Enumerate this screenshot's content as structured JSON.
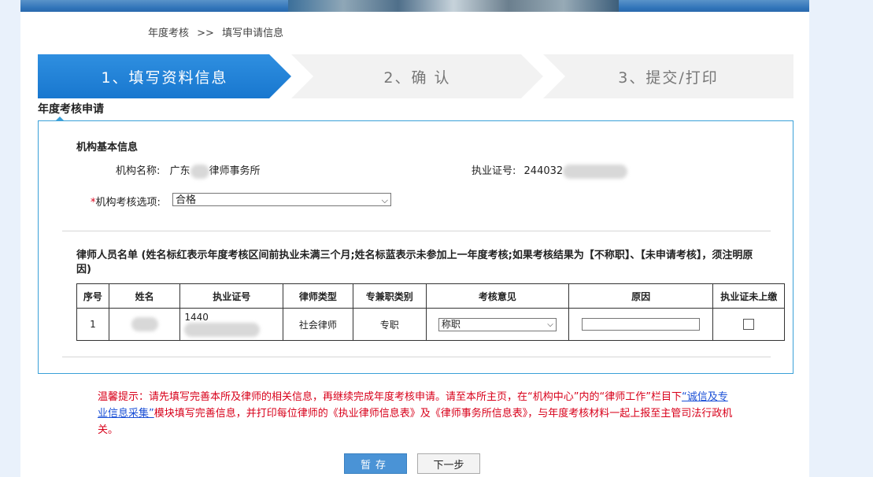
{
  "breadcrumb": {
    "root": "年度考核",
    "separator": ">>",
    "current": "填写申请信息"
  },
  "steps": [
    {
      "label": "1、填写资料信息",
      "active": true
    },
    {
      "label": "2、确 认",
      "active": false
    },
    {
      "label": "3、提交/打印",
      "active": false
    }
  ],
  "section_title": "年度考核申请",
  "org": {
    "heading": "机构基本信息",
    "name_label": "机构名称:",
    "name_prefix": "广东",
    "name_suffix": "律师事务所",
    "license_label": "执业证号:",
    "license_prefix": "244032",
    "review_label": "*机构考核选项:",
    "review_value": "合格"
  },
  "lawyers": {
    "title": "律师人员名单 (姓名标红表示年度考核区间前执业未满三个月;姓名标蓝表示未参加上一年度考核;如果考核结果为【不称职】、【未申请考核】，须注明原因)",
    "columns": [
      "序号",
      "姓名",
      "执业证号",
      "律师类型",
      "专兼职类别",
      "考核意见",
      "原因",
      "执业证未上缴"
    ],
    "rows": [
      {
        "index": "1",
        "license_prefix": "1440",
        "type": "社会律师",
        "category": "专职",
        "opinion": "称职"
      }
    ]
  },
  "tip": {
    "part1": "温馨提示：请先填写完善本所及律师的相关信息，再继续完成年度考核申请。请至本所主页，在“机构中心”内的“律师工作”栏目下",
    "link": "“诚信及专业信息采集”",
    "part2": "模块填写完善信息，并打印每位律师的《执业律师信息表》及《律师事务所信息表》，与年度考核材料一起上报至主管司法行政机关。"
  },
  "buttons": {
    "save": "暂存",
    "next": "下一步"
  },
  "colors": {
    "accent": "#1877cf",
    "panel_border": "#3aa0d8",
    "tip": "#d8001a"
  }
}
